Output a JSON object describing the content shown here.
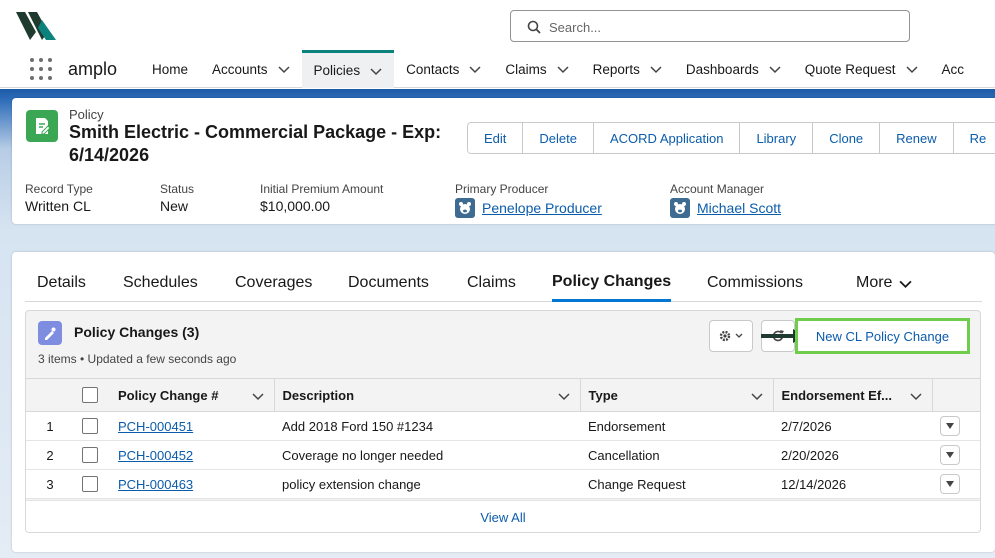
{
  "search": {
    "placeholder": "Search..."
  },
  "app": {
    "name": "amplo"
  },
  "nav": {
    "items": [
      {
        "label": "Home",
        "has_menu": false,
        "active": false
      },
      {
        "label": "Accounts",
        "has_menu": true,
        "active": false
      },
      {
        "label": "Policies",
        "has_menu": true,
        "active": true
      },
      {
        "label": "Contacts",
        "has_menu": true,
        "active": false
      },
      {
        "label": "Claims",
        "has_menu": true,
        "active": false
      },
      {
        "label": "Reports",
        "has_menu": true,
        "active": false
      },
      {
        "label": "Dashboards",
        "has_menu": true,
        "active": false
      },
      {
        "label": "Quote Request",
        "has_menu": true,
        "active": false
      },
      {
        "label": "Acc",
        "has_menu": false,
        "active": false
      }
    ]
  },
  "record": {
    "object_label": "Policy",
    "title": "Smith Electric - Commercial Package - Exp: 6/14/2026",
    "actions": [
      "Edit",
      "Delete",
      "ACORD Application",
      "Library",
      "Clone",
      "Renew",
      "Re"
    ],
    "highlights": [
      {
        "label": "Record Type",
        "value": "Written CL",
        "link": false
      },
      {
        "label": "Status",
        "value": "New",
        "link": false
      },
      {
        "label": "Initial Premium Amount",
        "value": "$10,000.00",
        "link": false
      },
      {
        "label": "Primary Producer",
        "value": "Penelope Producer",
        "link": true
      },
      {
        "label": "Account Manager",
        "value": "Michael Scott",
        "link": true
      }
    ]
  },
  "tabs": {
    "items": [
      "Details",
      "Schedules",
      "Coverages",
      "Documents",
      "Claims",
      "Policy Changes",
      "Commissions"
    ],
    "more_label": "More",
    "active": "Policy Changes"
  },
  "related_list": {
    "title": "Policy Changes (3)",
    "meta": "3 items • Updated a few seconds ago",
    "new_button": "New CL Policy Change",
    "columns": [
      "Policy Change #",
      "Description",
      "Type",
      "Endorsement Ef..."
    ],
    "rows": [
      {
        "num": "1",
        "id": "PCH-000451",
        "description": "Add 2018 Ford 150 #1234",
        "type": "Endorsement",
        "date": "2/7/2026"
      },
      {
        "num": "2",
        "id": "PCH-000452",
        "description": "Coverage no longer needed",
        "type": "Cancellation",
        "date": "2/20/2026"
      },
      {
        "num": "3",
        "id": "PCH-000463",
        "description": "policy extension change",
        "type": "Change Request",
        "date": "12/14/2026"
      }
    ],
    "view_all": "View All"
  },
  "colors": {
    "brand_teal": "#0b827c",
    "link_blue": "#0b5cab",
    "policy_icon_green": "#3ba755",
    "highlight_box_green": "#6fcd4b",
    "related_icon_purple": "#7f8de1"
  }
}
